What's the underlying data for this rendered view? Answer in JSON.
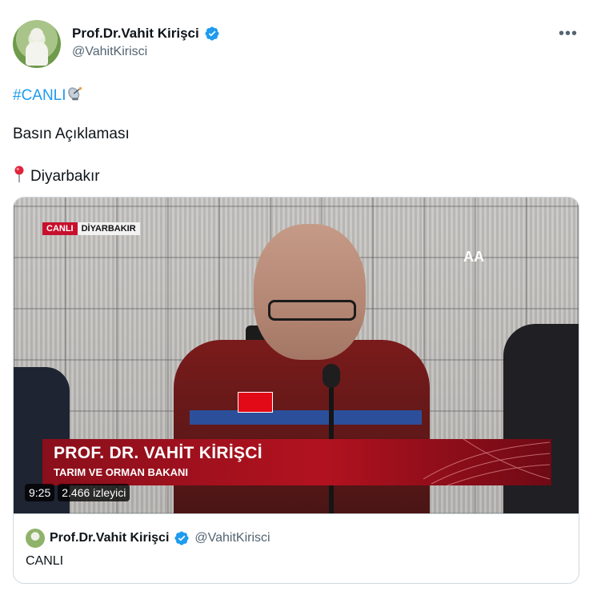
{
  "post": {
    "author": {
      "display_name": "Prof.Dr.Vahit Kirişci",
      "handle": "@VahitKirisci",
      "verified": true
    },
    "more_icon": "ellipsis-icon",
    "hashtag": "#CANLI",
    "hashtag_emoji": "satellite-antenna-icon",
    "line2": "Basın Açıklaması",
    "location_emoji": "round-pushpin-icon",
    "location": "Diyarbakır"
  },
  "video": {
    "live_label": "CANLI",
    "location_label": "DİYARBAKIR",
    "broadcaster_logo": "AA",
    "lower_third_name": "PROF. DR. VAHİT KİRİŞCİ",
    "lower_third_title": "TARIM VE ORMAN BAKANI",
    "duration": "9:25",
    "viewers": "2.466 izleyici"
  },
  "quoted": {
    "display_name": "Prof.Dr.Vahit Kirişci",
    "handle": "@VahitKirisci",
    "text": "CANLI"
  },
  "colors": {
    "link": "#1d9bf0",
    "verified": "#1d9bf0",
    "secondary_text": "#536471",
    "lower_third_red": "#b2121f"
  }
}
